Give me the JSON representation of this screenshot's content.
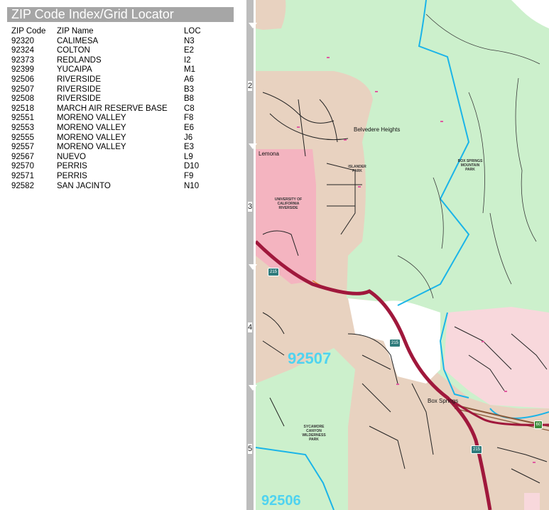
{
  "index": {
    "title": "ZIP Code Index/Grid Locator",
    "headers": {
      "code": "ZIP Code",
      "name": "ZIP Name",
      "loc": "LOC"
    },
    "rows": [
      {
        "code": "92320",
        "name": "CALIMESA",
        "loc": "N3"
      },
      {
        "code": "92324",
        "name": "COLTON",
        "loc": "E2"
      },
      {
        "code": "92373",
        "name": "REDLANDS",
        "loc": "I2"
      },
      {
        "code": "92399",
        "name": "YUCAIPA",
        "loc": "M1"
      },
      {
        "code": "92506",
        "name": "RIVERSIDE",
        "loc": "A6"
      },
      {
        "code": "92507",
        "name": "RIVERSIDE",
        "loc": "B3"
      },
      {
        "code": "92508",
        "name": "RIVERSIDE",
        "loc": "B8"
      },
      {
        "code": "92518",
        "name": "MARCH AIR RESERVE BASE",
        "loc": "C8"
      },
      {
        "code": "92551",
        "name": "MORENO VALLEY",
        "loc": "F8"
      },
      {
        "code": "92553",
        "name": "MORENO VALLEY",
        "loc": "E6"
      },
      {
        "code": "92555",
        "name": "MORENO VALLEY",
        "loc": "J6"
      },
      {
        "code": "92557",
        "name": "MORENO VALLEY",
        "loc": "E3"
      },
      {
        "code": "92567",
        "name": "NUEVO",
        "loc": "L9"
      },
      {
        "code": "92570",
        "name": "PERRIS",
        "loc": "D10"
      },
      {
        "code": "92571",
        "name": "PERRIS",
        "loc": "F9"
      },
      {
        "code": "92582",
        "name": "SAN JACINTO",
        "loc": "N10"
      }
    ]
  },
  "grid": {
    "rows": [
      "2",
      "3",
      "4",
      "5"
    ]
  },
  "map": {
    "places": {
      "belvedere": "Belvedere Heights",
      "lemona": "Lemona",
      "box_springs": "Box Springs"
    },
    "parks": {
      "box_springs_park": "BOX SPRINGS MOUNTAIN PARK",
      "islander_park": "ISLANDER PARK",
      "university": "UNIVERSITY OF CALIFORNIA RIVERSIDE",
      "sycamore": "SYCAMORE CANYON WILDERNESS PARK"
    },
    "zips": {
      "z92507": "92507",
      "z92506": "92506"
    },
    "highways": {
      "i215a": "215",
      "i215b": "215",
      "i215c": "215",
      "sr60": "60"
    },
    "colors": {
      "park": "#ccf0cc",
      "urban": "#e8d2c0",
      "campus": "#f4b4c0",
      "residential": "#f8d8dc",
      "highway": "#a0183c",
      "zip_boundary": "#1ab4e8",
      "zip_label": "#4fd3f0"
    }
  }
}
